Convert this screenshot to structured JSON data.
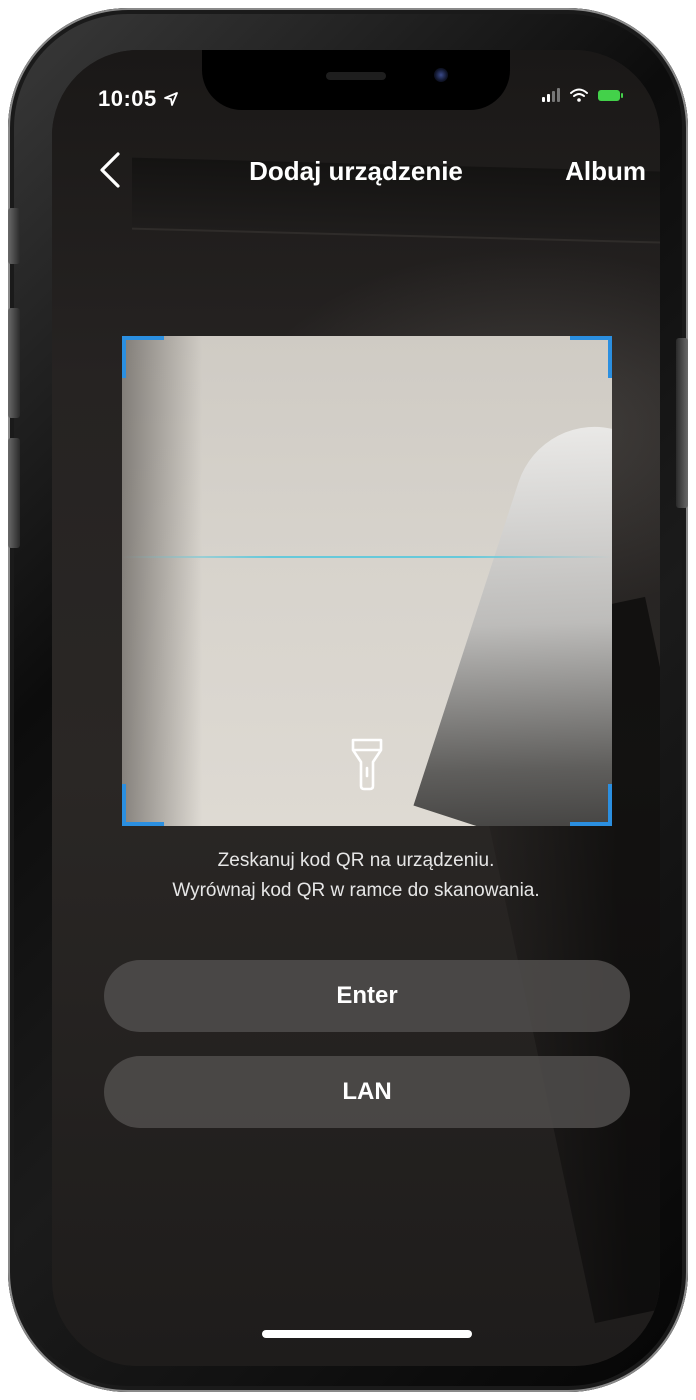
{
  "status_bar": {
    "time": "10:05",
    "location_icon": "location-arrow-icon",
    "signal_icon": "cellular-signal-icon",
    "wifi_icon": "wifi-icon",
    "battery_icon": "battery-charging-icon"
  },
  "nav": {
    "back_icon": "chevron-left-icon",
    "title": "Dodaj urządzenie",
    "album_label": "Album"
  },
  "scanner": {
    "flashlight_icon": "flashlight-icon",
    "corner_color": "#2b8fe0",
    "scan_line_color": "#5ac8dc"
  },
  "hint": {
    "line1": "Zeskanuj kod QR na urządzeniu.",
    "line2": "Wyrównaj kod QR w ramce do skanowania."
  },
  "buttons": {
    "enter_label": "Enter",
    "lan_label": "LAN"
  }
}
